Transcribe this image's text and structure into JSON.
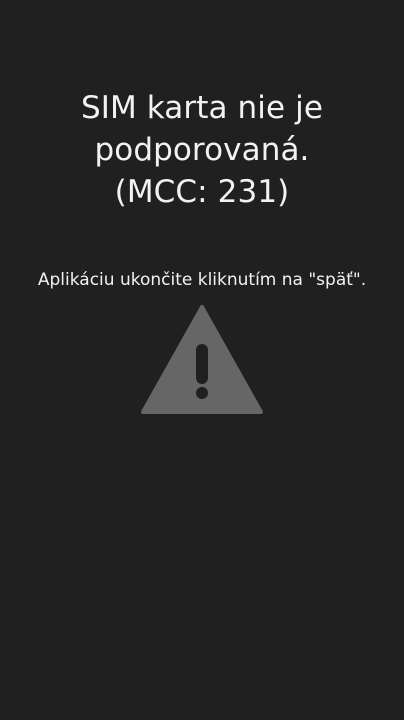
{
  "message": {
    "title_lines": [
      "SIM karta nie je",
      "podporovaná.",
      "(MCC: 231)"
    ],
    "instruction": "Aplikáciu ukončite kliknutím na \"späť\"."
  },
  "icon": {
    "name": "warning-icon",
    "color": "#666666",
    "mark_color": "#202020"
  },
  "colors": {
    "background": "#202020",
    "text": "#f2f2f2"
  }
}
